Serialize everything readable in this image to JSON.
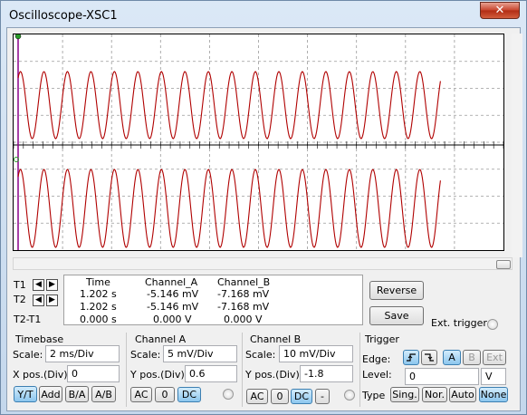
{
  "window": {
    "title": "Oscilloscope-XSC1",
    "close_label": "✕"
  },
  "measurements": {
    "columns": [
      "Time",
      "Channel_A",
      "Channel_B"
    ],
    "rows": [
      {
        "label": "T1",
        "time": "1.202 s",
        "a": "-5.146 mV",
        "b": "-7.168 mV"
      },
      {
        "label": "T2",
        "time": "1.202 s",
        "a": "-5.146 mV",
        "b": "-7.168 mV"
      },
      {
        "label": "T2-T1",
        "time": "0.000 s",
        "a": "0.000 V",
        "b": "0.000 V"
      }
    ],
    "arrow_left": "◀",
    "arrow_right": "▶"
  },
  "controls": {
    "reverse_label": "Reverse",
    "save_label": "Save",
    "ext_trigger_label": "Ext. trigger"
  },
  "timebase": {
    "title": "Timebase",
    "scale_label": "Scale:",
    "scale_value": "2 ms/Div",
    "xpos_label": "X pos.(Div):",
    "xpos_value": "0",
    "buttons": [
      "Y/T",
      "Add",
      "B/A",
      "A/B"
    ],
    "selected": "Y/T"
  },
  "channel_a": {
    "title": "Channel A",
    "scale_label": "Scale:",
    "scale_value": "5 mV/Div",
    "ypos_label": "Y pos.(Div):",
    "ypos_value": "0.6",
    "buttons": [
      "AC",
      "0",
      "DC"
    ],
    "selected": "DC"
  },
  "channel_b": {
    "title": "Channel B",
    "scale_label": "Scale:",
    "scale_value": "10 mV/Div",
    "ypos_label": "Y pos.(Div):",
    "ypos_value": "-1.8",
    "buttons": [
      "AC",
      "0",
      "DC",
      "-"
    ],
    "selected": "DC"
  },
  "trigger": {
    "title": "Trigger",
    "edge_label": "Edge:",
    "edge_buttons": [
      "A",
      "B",
      "Ext"
    ],
    "edge_selected": "A",
    "level_label": "Level:",
    "level_value": "0",
    "level_unit": "V",
    "type_label": "Type",
    "type_buttons": [
      "Sing.",
      "Nor.",
      "Auto",
      "None"
    ],
    "type_selected": "None"
  },
  "colors": {
    "trace": "#b00000",
    "cursor": "#8b008b",
    "grid": "#9a9a9a"
  }
}
